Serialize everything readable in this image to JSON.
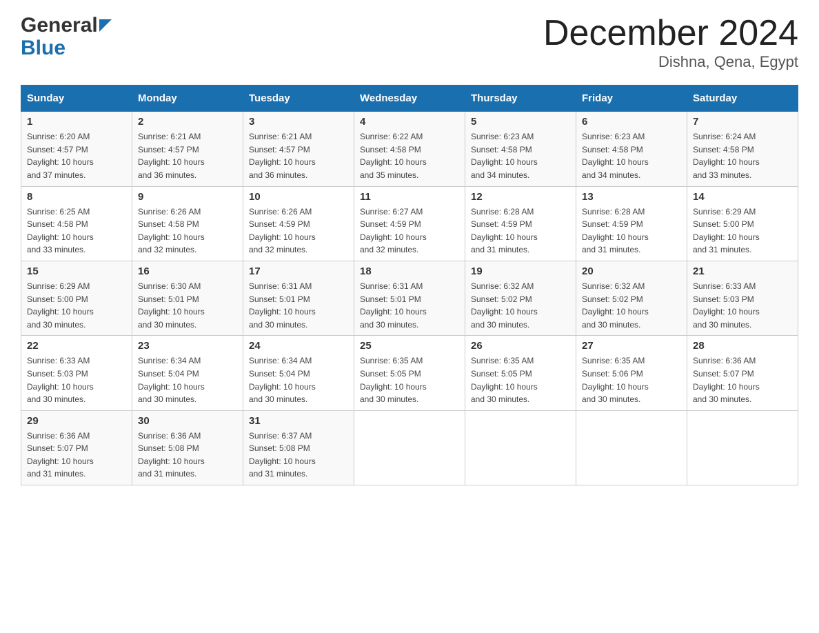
{
  "header": {
    "logo_general": "General",
    "logo_blue": "Blue",
    "month_title": "December 2024",
    "location": "Dishna, Qena, Egypt"
  },
  "days_of_week": [
    "Sunday",
    "Monday",
    "Tuesday",
    "Wednesday",
    "Thursday",
    "Friday",
    "Saturday"
  ],
  "weeks": [
    [
      {
        "day": "1",
        "sunrise": "6:20 AM",
        "sunset": "4:57 PM",
        "daylight": "10 hours and 37 minutes."
      },
      {
        "day": "2",
        "sunrise": "6:21 AM",
        "sunset": "4:57 PM",
        "daylight": "10 hours and 36 minutes."
      },
      {
        "day": "3",
        "sunrise": "6:21 AM",
        "sunset": "4:57 PM",
        "daylight": "10 hours and 36 minutes."
      },
      {
        "day": "4",
        "sunrise": "6:22 AM",
        "sunset": "4:58 PM",
        "daylight": "10 hours and 35 minutes."
      },
      {
        "day": "5",
        "sunrise": "6:23 AM",
        "sunset": "4:58 PM",
        "daylight": "10 hours and 34 minutes."
      },
      {
        "day": "6",
        "sunrise": "6:23 AM",
        "sunset": "4:58 PM",
        "daylight": "10 hours and 34 minutes."
      },
      {
        "day": "7",
        "sunrise": "6:24 AM",
        "sunset": "4:58 PM",
        "daylight": "10 hours and 33 minutes."
      }
    ],
    [
      {
        "day": "8",
        "sunrise": "6:25 AM",
        "sunset": "4:58 PM",
        "daylight": "10 hours and 33 minutes."
      },
      {
        "day": "9",
        "sunrise": "6:26 AM",
        "sunset": "4:58 PM",
        "daylight": "10 hours and 32 minutes."
      },
      {
        "day": "10",
        "sunrise": "6:26 AM",
        "sunset": "4:59 PM",
        "daylight": "10 hours and 32 minutes."
      },
      {
        "day": "11",
        "sunrise": "6:27 AM",
        "sunset": "4:59 PM",
        "daylight": "10 hours and 32 minutes."
      },
      {
        "day": "12",
        "sunrise": "6:28 AM",
        "sunset": "4:59 PM",
        "daylight": "10 hours and 31 minutes."
      },
      {
        "day": "13",
        "sunrise": "6:28 AM",
        "sunset": "4:59 PM",
        "daylight": "10 hours and 31 minutes."
      },
      {
        "day": "14",
        "sunrise": "6:29 AM",
        "sunset": "5:00 PM",
        "daylight": "10 hours and 31 minutes."
      }
    ],
    [
      {
        "day": "15",
        "sunrise": "6:29 AM",
        "sunset": "5:00 PM",
        "daylight": "10 hours and 30 minutes."
      },
      {
        "day": "16",
        "sunrise": "6:30 AM",
        "sunset": "5:01 PM",
        "daylight": "10 hours and 30 minutes."
      },
      {
        "day": "17",
        "sunrise": "6:31 AM",
        "sunset": "5:01 PM",
        "daylight": "10 hours and 30 minutes."
      },
      {
        "day": "18",
        "sunrise": "6:31 AM",
        "sunset": "5:01 PM",
        "daylight": "10 hours and 30 minutes."
      },
      {
        "day": "19",
        "sunrise": "6:32 AM",
        "sunset": "5:02 PM",
        "daylight": "10 hours and 30 minutes."
      },
      {
        "day": "20",
        "sunrise": "6:32 AM",
        "sunset": "5:02 PM",
        "daylight": "10 hours and 30 minutes."
      },
      {
        "day": "21",
        "sunrise": "6:33 AM",
        "sunset": "5:03 PM",
        "daylight": "10 hours and 30 minutes."
      }
    ],
    [
      {
        "day": "22",
        "sunrise": "6:33 AM",
        "sunset": "5:03 PM",
        "daylight": "10 hours and 30 minutes."
      },
      {
        "day": "23",
        "sunrise": "6:34 AM",
        "sunset": "5:04 PM",
        "daylight": "10 hours and 30 minutes."
      },
      {
        "day": "24",
        "sunrise": "6:34 AM",
        "sunset": "5:04 PM",
        "daylight": "10 hours and 30 minutes."
      },
      {
        "day": "25",
        "sunrise": "6:35 AM",
        "sunset": "5:05 PM",
        "daylight": "10 hours and 30 minutes."
      },
      {
        "day": "26",
        "sunrise": "6:35 AM",
        "sunset": "5:05 PM",
        "daylight": "10 hours and 30 minutes."
      },
      {
        "day": "27",
        "sunrise": "6:35 AM",
        "sunset": "5:06 PM",
        "daylight": "10 hours and 30 minutes."
      },
      {
        "day": "28",
        "sunrise": "6:36 AM",
        "sunset": "5:07 PM",
        "daylight": "10 hours and 30 minutes."
      }
    ],
    [
      {
        "day": "29",
        "sunrise": "6:36 AM",
        "sunset": "5:07 PM",
        "daylight": "10 hours and 31 minutes."
      },
      {
        "day": "30",
        "sunrise": "6:36 AM",
        "sunset": "5:08 PM",
        "daylight": "10 hours and 31 minutes."
      },
      {
        "day": "31",
        "sunrise": "6:37 AM",
        "sunset": "5:08 PM",
        "daylight": "10 hours and 31 minutes."
      },
      null,
      null,
      null,
      null
    ]
  ],
  "labels": {
    "sunrise": "Sunrise:",
    "sunset": "Sunset:",
    "daylight": "Daylight:"
  }
}
